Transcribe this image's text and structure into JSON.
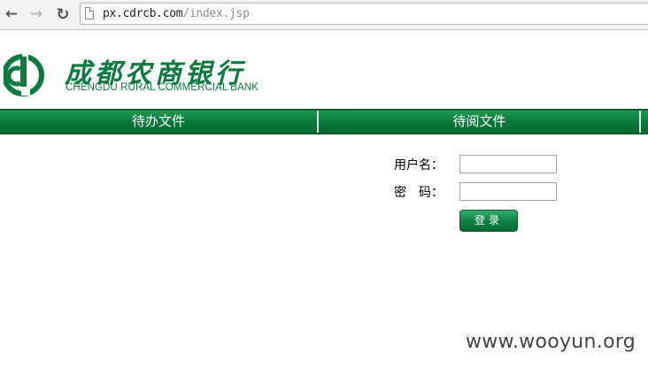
{
  "browser": {
    "back_icon": "arrow-left-icon",
    "forward_icon": "arrow-right-icon",
    "reload_icon": "reload-icon",
    "url_host": "px.cdrcb.com",
    "url_path": "/index.jsp"
  },
  "header": {
    "bank_name_cn": "成都农商银行",
    "bank_name_en": "CHENGDU RURAL COMMERCIAL BANK"
  },
  "nav": {
    "tabs": [
      {
        "label": "待办文件"
      },
      {
        "label": "待阅文件"
      }
    ]
  },
  "login": {
    "username_label": "用户名：",
    "password_label": "密　码：",
    "username_value": "",
    "password_value": "",
    "submit_label": "登录"
  },
  "watermark": "www.wooyun.org",
  "colors": {
    "brand_green": "#0b7a3d"
  }
}
